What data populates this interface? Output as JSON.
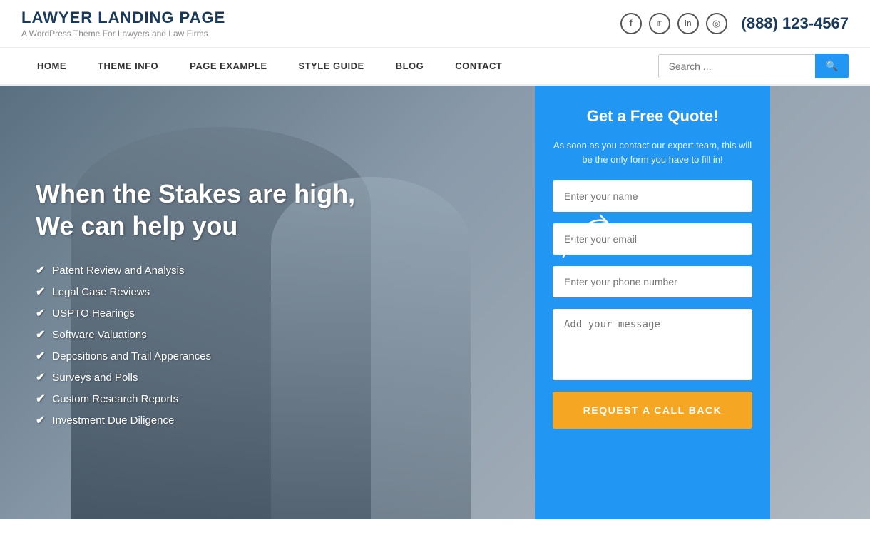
{
  "site": {
    "logo_title": "LAWYER LANDING PAGE",
    "logo_subtitle": "A WordPress Theme For Lawyers and Law Firms"
  },
  "header": {
    "phone": "(888) 123-4567",
    "social": [
      {
        "name": "facebook",
        "symbol": "f"
      },
      {
        "name": "twitter",
        "symbol": "t"
      },
      {
        "name": "linkedin",
        "symbol": "in"
      },
      {
        "name": "instagram",
        "symbol": "◎"
      }
    ]
  },
  "nav": {
    "links": [
      {
        "label": "HOME",
        "id": "home"
      },
      {
        "label": "THEME INFO",
        "id": "theme-info"
      },
      {
        "label": "PAGE EXAMPLE",
        "id": "page-example"
      },
      {
        "label": "STYLE GUIDE",
        "id": "style-guide"
      },
      {
        "label": "BLOG",
        "id": "blog"
      },
      {
        "label": "CONTACT",
        "id": "contact"
      }
    ],
    "search_placeholder": "Search ..."
  },
  "hero": {
    "headline": "When the Stakes are high,\nWe can help you",
    "checklist": [
      "Patent Review and Analysis",
      "Legal Case Reviews",
      "USPTO Hearings",
      "Software Valuations",
      "Depcsitions and Trail Apperances",
      "Surveys and Polls",
      "Custom Research Reports",
      "Investment Due Diligence"
    ]
  },
  "form": {
    "title": "Get a Free Quote!",
    "subtitle": "As soon as you contact our expert team, this will be the only form you have to fill in!",
    "name_placeholder": "Enter your name",
    "email_placeholder": "Enter your email",
    "phone_placeholder": "Enter your phone number",
    "message_placeholder": "Add your message",
    "submit_label": "REQUEST A CALL BACK"
  }
}
